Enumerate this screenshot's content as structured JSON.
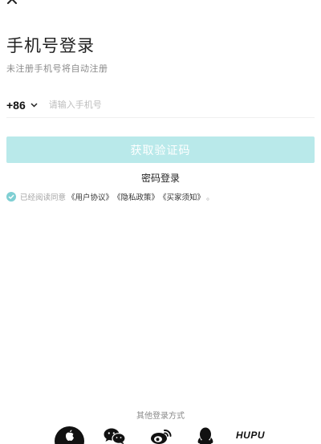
{
  "header": {
    "title": "手机号登录",
    "subtitle": "未注册手机号将自动注册"
  },
  "phone": {
    "country_code": "+86",
    "placeholder": "请输入手机号"
  },
  "actions": {
    "get_code_label": "获取验证码",
    "password_login_label": "密码登录"
  },
  "agreement": {
    "prefix": "已经阅读同意",
    "links": [
      "《用户协议》",
      "《隐私政策》",
      "《买家须知》"
    ],
    "suffix": "。",
    "checked": true
  },
  "other_login": {
    "title": "其他登录方式",
    "methods": [
      "apple-icon",
      "wechat-icon",
      "weibo-icon",
      "qq-icon",
      "hupu-logo"
    ],
    "hupu_label": "HUPU"
  },
  "colors": {
    "accent": "#b9e9ea",
    "check": "#7fcfd3",
    "muted": "#8a8a8a"
  }
}
